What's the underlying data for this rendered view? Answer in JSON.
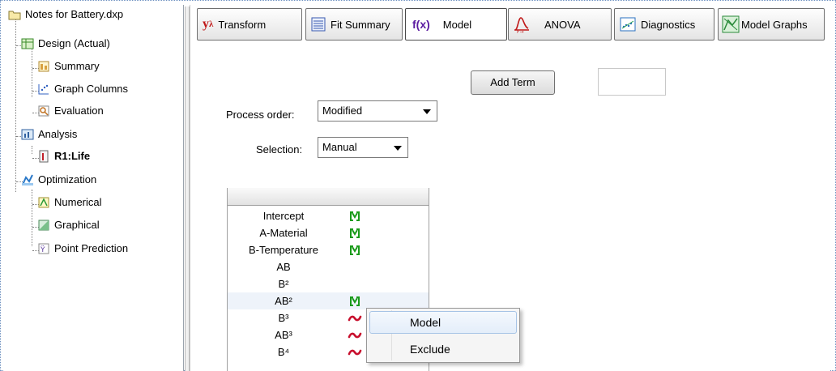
{
  "tree": {
    "root": "Notes for Battery.dxp",
    "design": "Design (Actual)",
    "summary": "Summary",
    "graph_columns": "Graph Columns",
    "evaluation": "Evaluation",
    "analysis": "Analysis",
    "response": "R1:Life",
    "optimization": "Optimization",
    "numerical": "Numerical",
    "graphical": "Graphical",
    "point_prediction": "Point Prediction"
  },
  "toolbar": {
    "transform_sym": "y",
    "transform_sup": "λ",
    "transform": "Transform",
    "fit_summary": "Fit Summary",
    "model_sym": "f(x)",
    "model": "Model",
    "anova": "ANOVA",
    "diagnostics": "Diagnostics",
    "model_graphs": "Model Graphs"
  },
  "controls": {
    "add_term": "Add Term",
    "term_value": "",
    "process_order_label": "Process order:",
    "process_order_value": "Modified",
    "selection_label": "Selection:",
    "selection_value": "Manual"
  },
  "terms": [
    {
      "name": "Intercept",
      "state": "M"
    },
    {
      "name": "A-Material",
      "state": "M"
    },
    {
      "name": "B-Temperature",
      "state": "M"
    },
    {
      "name": "AB",
      "state": ""
    },
    {
      "name": "B²",
      "state": ""
    },
    {
      "name": "AB²",
      "state": "M"
    },
    {
      "name": "B³",
      "state": "~"
    },
    {
      "name": "AB³",
      "state": "~"
    },
    {
      "name": "B⁴",
      "state": "~"
    }
  ],
  "context_menu": {
    "items": [
      "Model",
      "Exclude"
    ]
  },
  "colors": {
    "model_marker": "#1a9a1a",
    "aliased_marker": "#c8102e",
    "selected_row": "#eef3fa"
  }
}
